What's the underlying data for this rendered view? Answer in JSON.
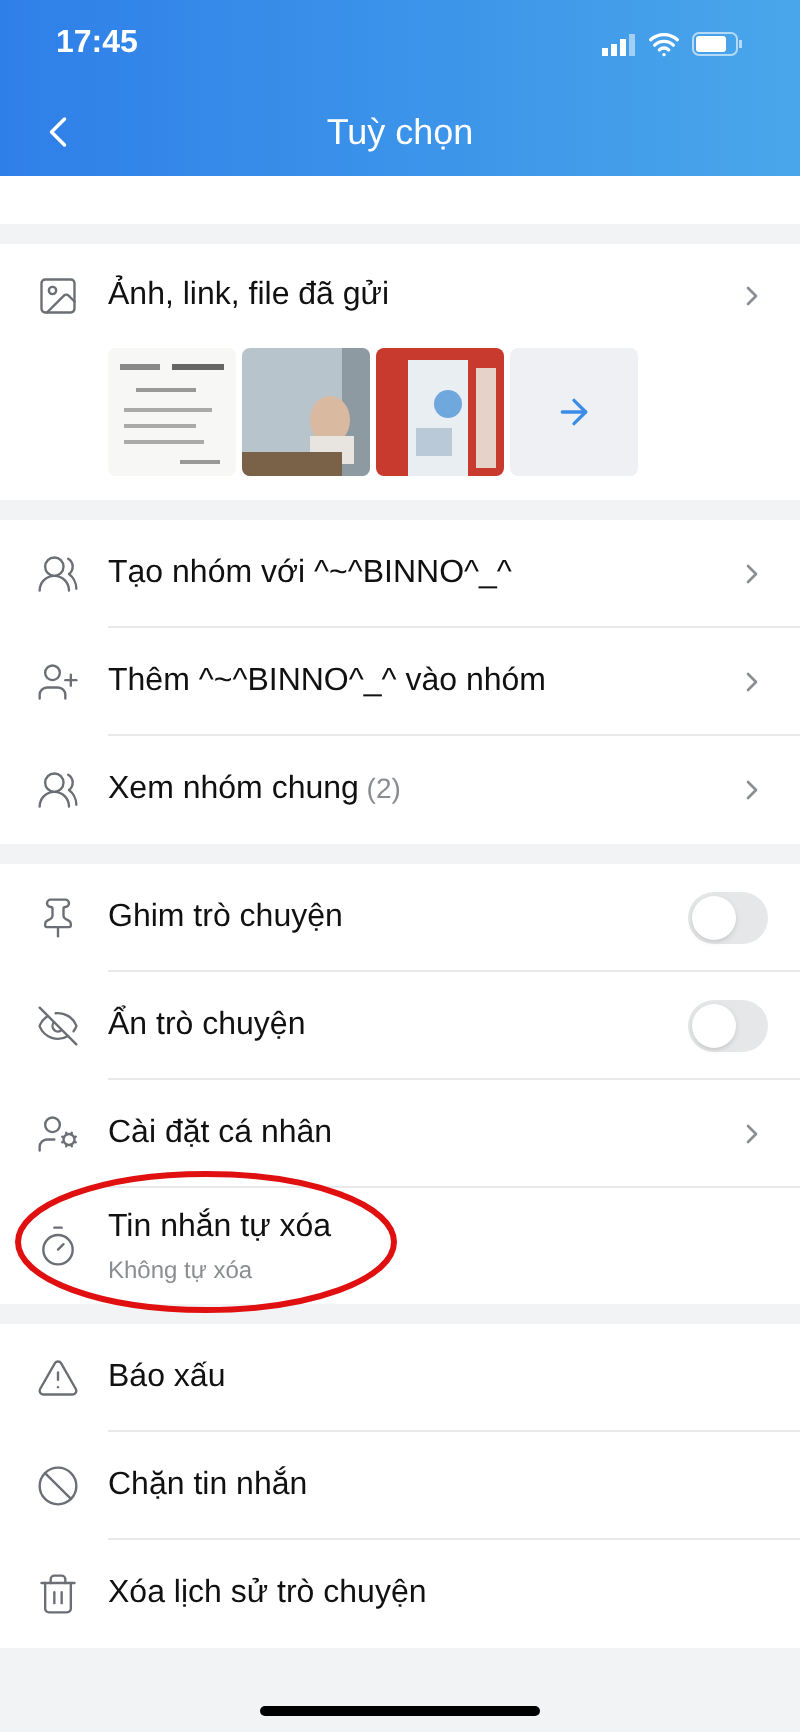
{
  "status_bar": {
    "time": "17:45"
  },
  "header": {
    "title": "Tuỳ chọn"
  },
  "media": {
    "label": "Ảnh, link, file đã gửi",
    "thumbnails": [
      {
        "kind": "picture"
      },
      {
        "kind": "picture"
      },
      {
        "kind": "picture"
      },
      {
        "kind": "more"
      }
    ]
  },
  "sections": [
    {
      "rows": [
        {
          "kind": "link",
          "label": "Tạo nhóm với ^~^BINNO^_^",
          "highlighted": false
        },
        {
          "kind": "link",
          "label": "Thêm ^~^BINNO^_^ vào nhóm",
          "highlighted": false
        },
        {
          "kind": "link",
          "label": "Xem nhóm chung",
          "count": "(2)",
          "highlighted": false
        }
      ]
    },
    {
      "rows": [
        {
          "kind": "toggle",
          "label": "Ghim trò chuyện",
          "on": false,
          "highlighted": false
        },
        {
          "kind": "toggle",
          "label": "Ẩn trò chuyện",
          "on": false,
          "highlighted": false
        },
        {
          "kind": "link",
          "label": "Cài đặt cá nhân",
          "highlighted": false
        },
        {
          "kind": "plain",
          "label": "Tin nhắn tự xóa",
          "subtitle": "Không tự xóa",
          "highlighted": true
        }
      ]
    },
    {
      "rows": [
        {
          "kind": "plain",
          "label": "Báo xấu",
          "highlighted": false
        },
        {
          "kind": "plain",
          "label": "Chặn tin nhắn",
          "highlighted": false
        },
        {
          "kind": "plain",
          "label": "Xóa lịch sử trò chuyện",
          "highlighted": false
        }
      ]
    }
  ]
}
